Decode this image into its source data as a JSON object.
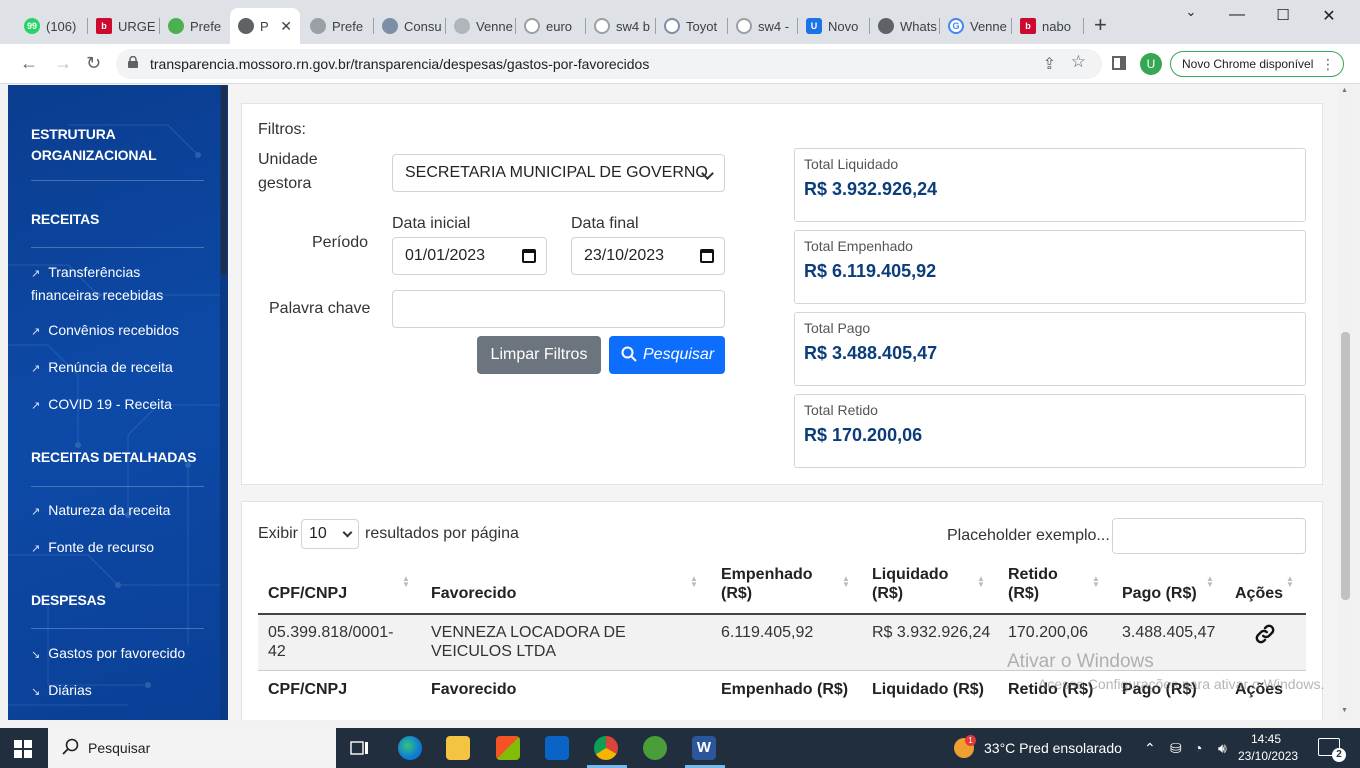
{
  "browser": {
    "tabs": [
      {
        "label": "(106) ",
        "icon": "whatsapp-icon"
      },
      {
        "label": "URGE",
        "icon": "bradesco-icon"
      },
      {
        "label": "Prefe",
        "icon": "prefeitura-icon"
      },
      {
        "label": "P",
        "icon": "globe-icon",
        "active": true
      },
      {
        "label": "Prefe",
        "icon": "globe-icon"
      },
      {
        "label": "Consu",
        "icon": "consulta-icon"
      },
      {
        "label": "Venne",
        "icon": "venneza-icon"
      },
      {
        "label": "euro",
        "icon": "google-icon"
      },
      {
        "label": "sw4 b",
        "icon": "google-icon"
      },
      {
        "label": "Toyot",
        "icon": "toyota-icon"
      },
      {
        "label": "sw4 -",
        "icon": "google-icon"
      },
      {
        "label": "Novo",
        "icon": "magnet-icon"
      },
      {
        "label": "Whats",
        "icon": "globe-icon"
      },
      {
        "label": "Venne",
        "icon": "google-icon"
      },
      {
        "label": "nabo",
        "icon": "bradesco-icon"
      }
    ],
    "url": "transparencia.mossoro.rn.gov.br/transparencia/despesas/gastos-por-favorecidos",
    "profile_initial": "U",
    "update_label": "Novo Chrome disponível"
  },
  "sidebar": {
    "sections": [
      {
        "title": "ESTRUTURA ORGANIZACIONAL",
        "items": []
      },
      {
        "title": "RECEITAS",
        "items": [
          "Transferências financeiras recebidas",
          "Convênios recebidos",
          "Renúncia de receita",
          "COVID 19 - Receita"
        ]
      },
      {
        "title": "RECEITAS DETALHADAS",
        "items": [
          "Natureza da receita",
          "Fonte de recurso"
        ]
      },
      {
        "title": "DESPESAS",
        "items": [
          "Gastos por favorecido",
          "Diárias"
        ]
      }
    ]
  },
  "filters": {
    "heading": "Filtros:",
    "unidade_label": "Unidade gestora",
    "unidade_value": "SECRETARIA MUNICIPAL DE GOVERNO",
    "periodo_label": "Período",
    "data_inicial_label": "Data inicial",
    "data_inicial_value": "01/01/2023",
    "data_final_label": "Data final",
    "data_final_value": "23/10/2023",
    "palavra_label": "Palavra chave",
    "palavra_value": "",
    "clear_button": "Limpar Filtros",
    "search_button": "Pesquisar"
  },
  "totals": [
    {
      "label": "Total Liquidado",
      "value": "R$ 3.932.926,24"
    },
    {
      "label": "Total Empenhado",
      "value": "R$ 6.119.405,92"
    },
    {
      "label": "Total Pago",
      "value": "R$ 3.488.405,47"
    },
    {
      "label": "Total Retido",
      "value": "R$ 170.200,06"
    }
  ],
  "table": {
    "show_prefix": "Exibir",
    "page_size": "10",
    "show_suffix": "resultados por página",
    "search_placeholder": "Placeholder exemplo...",
    "headers": [
      "CPF/CNPJ",
      "Favorecido",
      "Empenhado (R$)",
      "Liquidado (R$)",
      "Retido (R$)",
      "Pago (R$)",
      "Ações"
    ],
    "rows": [
      {
        "cpf": "05.399.818/0001-42",
        "favorecido": "VENNEZA LOCADORA DE VEICULOS LTDA",
        "empenhado": "6.119.405,92",
        "liquidado": "R$ 3.932.926,24",
        "retido": "170.200,06",
        "pago": "3.488.405,47",
        "acao_icon": "link-icon"
      }
    ],
    "footer_headers": [
      "CPF/CNPJ",
      "Favorecido",
      "Empenhado (R$)",
      "Liquidado (R$)",
      "Retido (R$)",
      "Pago (R$)",
      "Ações"
    ]
  },
  "watermark": {
    "line1": "Ativar o Windows",
    "line2": "Acesse Configurações para ativar o Windows."
  },
  "taskbar": {
    "search_placeholder": "Pesquisar",
    "weather": "33°C  Pred ensolarado",
    "time": "14:45",
    "date": "23/10/2023",
    "notification_count": "2"
  }
}
